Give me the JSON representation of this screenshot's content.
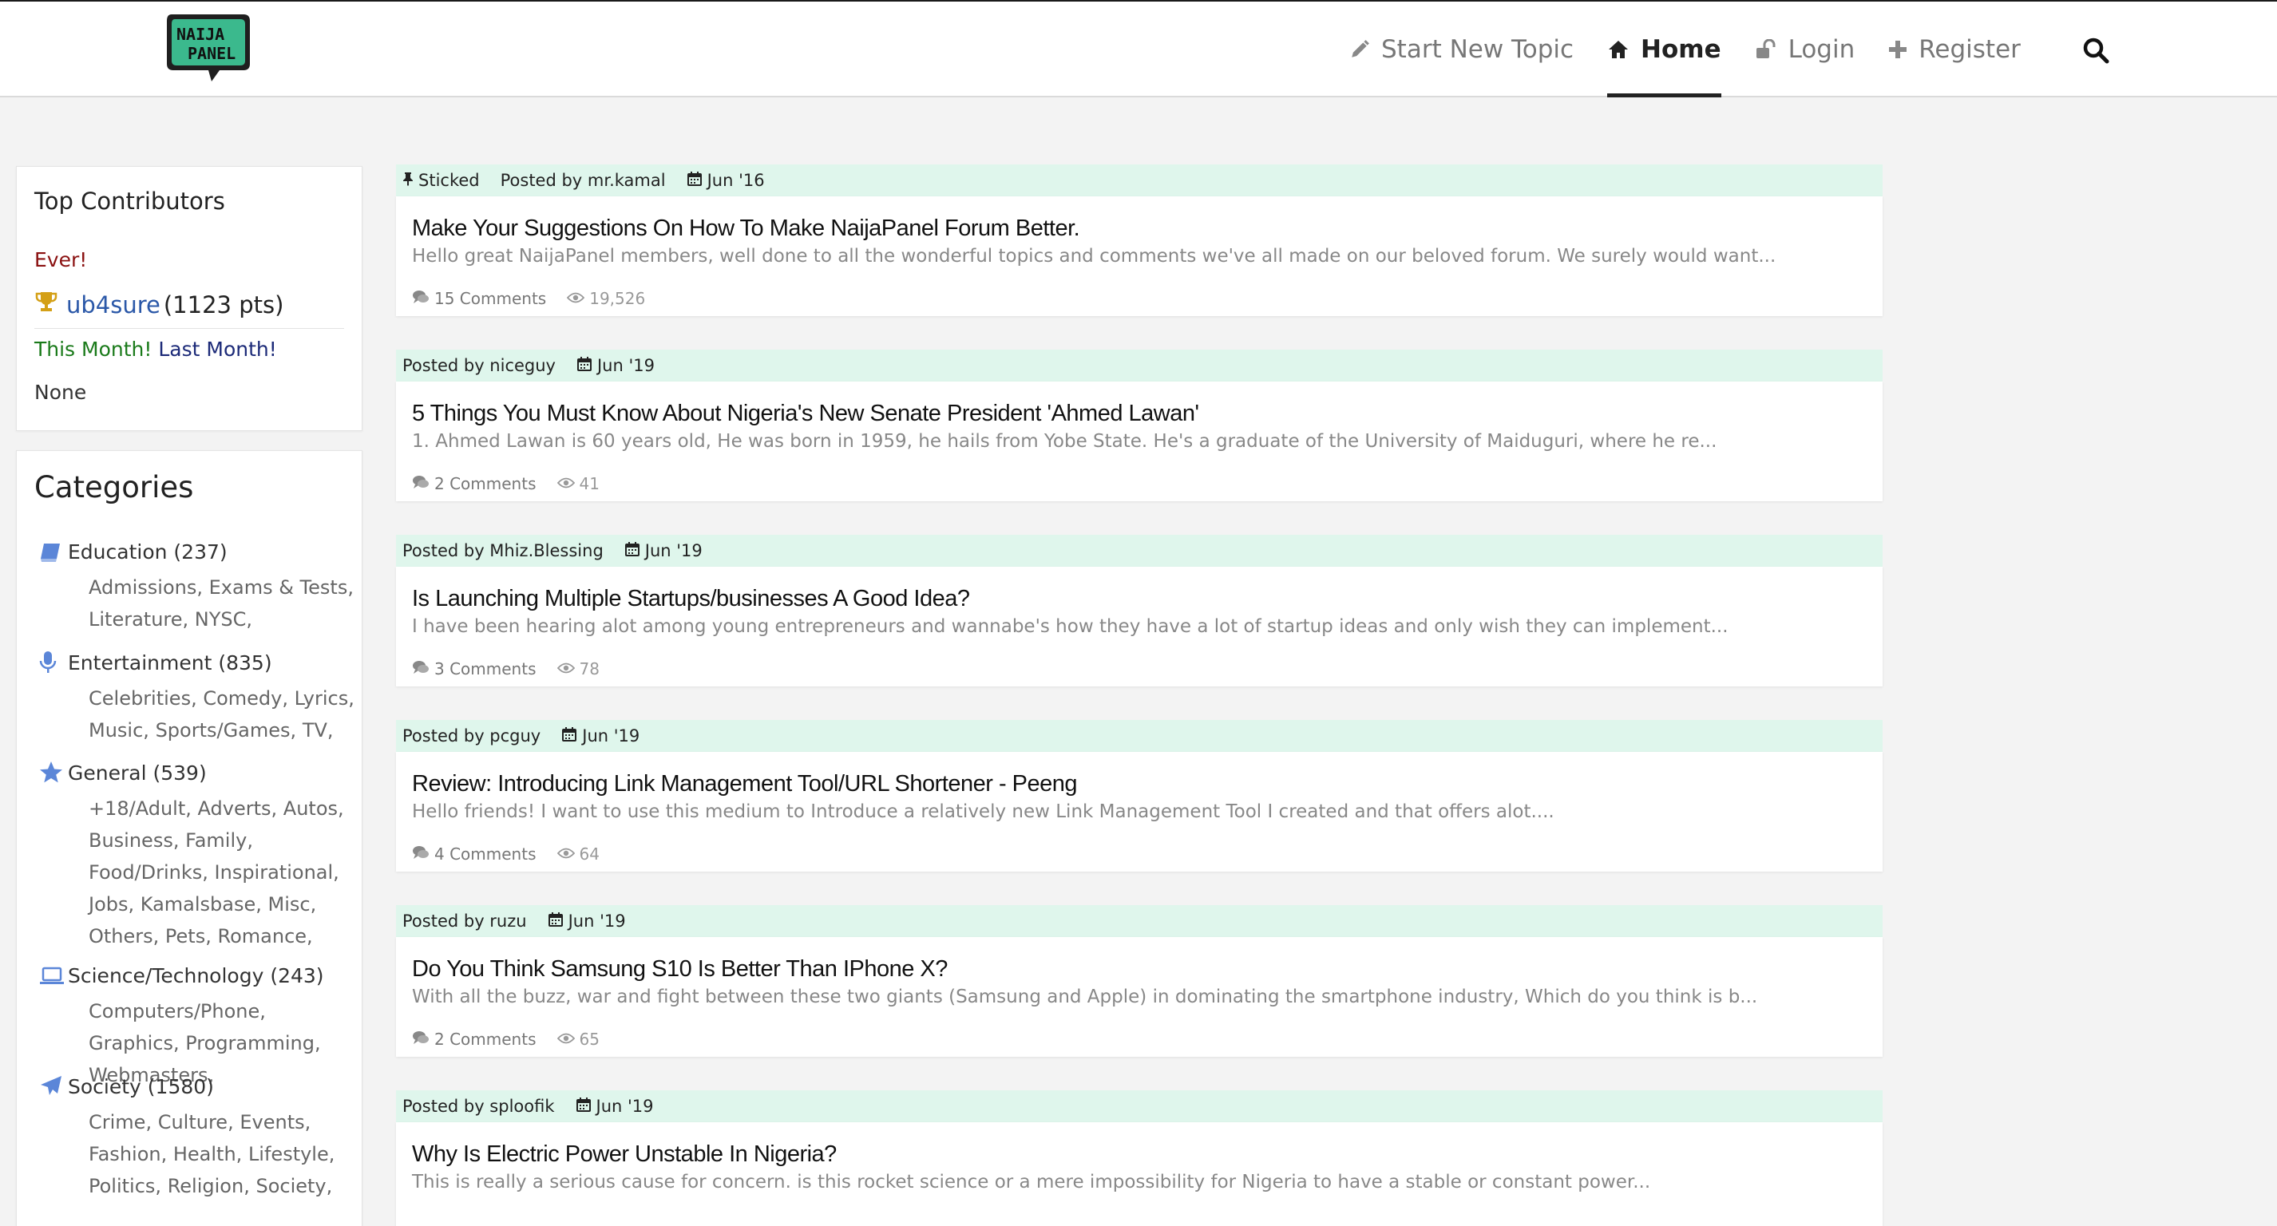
{
  "brand": {
    "logo_line1": "NAIJA",
    "logo_line2": "PANEL",
    "logo_color": "#3bb98d"
  },
  "nav": {
    "start_new_topic": "Start New Topic",
    "home": "Home",
    "login": "Login",
    "register": "Register"
  },
  "contributors": {
    "title": "Top Contributors",
    "ever_label": "Ever!",
    "top_user": {
      "name": "ub4sure",
      "points": "(1123 pts)"
    },
    "this_month": "This Month!",
    "last_month": "Last Month!",
    "none_text": "None"
  },
  "categories": {
    "title": "Categories",
    "items": [
      {
        "name": "Education (237)",
        "icon": "book-icon",
        "subs": [
          "Admissions",
          "Exams & Tests",
          "Literature",
          "NYSC"
        ]
      },
      {
        "name": "Entertainment (835)",
        "icon": "microphone-icon",
        "subs": [
          "Celebrities",
          "Comedy",
          "Lyrics",
          "Music",
          "Sports/Games",
          "TV"
        ]
      },
      {
        "name": "General (539)",
        "icon": "star-icon",
        "subs": [
          "+18/Adult",
          "Adverts",
          "Autos",
          "Business",
          "Family",
          "Food/Drinks",
          "Inspirational",
          "Jobs",
          "Kamalsbase",
          "Misc",
          "Others",
          "Pets",
          "Romance"
        ]
      },
      {
        "name": "Science/Technology (243)",
        "icon": "laptop-icon",
        "subs": [
          "Computers/Phone",
          "Graphics",
          "Programming",
          "Webmasters"
        ]
      },
      {
        "name": "Society (1580)",
        "icon": "plane-icon",
        "subs": [
          "Crime",
          "Culture",
          "Events",
          "Fashion",
          "Health",
          "Lifestyle",
          "Politics",
          "Religion",
          "Society"
        ]
      }
    ]
  },
  "posts": [
    {
      "sticked": "Sticked",
      "author": "Posted by mr.kamal",
      "date": "Jun '16",
      "title": "Make Your Suggestions On How To Make NaijaPanel Forum Better.",
      "excerpt": "Hello great NaijaPanel members, well done to all the wonderful topics and comments we've all made on our beloved forum. We surely would want...",
      "comments": "15 Comments",
      "views": "19,526"
    },
    {
      "author": "Posted by niceguy",
      "date": "Jun '19",
      "title": "5 Things You Must Know About Nigeria's New Senate President 'Ahmed Lawan'",
      "excerpt": "1. Ahmed Lawan is 60 years old, He was born in 1959, he hails from Yobe State. He's a graduate of the University of Maiduguri, where he re...",
      "comments": "2 Comments",
      "views": "41"
    },
    {
      "author": "Posted by Mhiz.Blessing",
      "date": "Jun '19",
      "title": "Is Launching Multiple Startups/businesses A Good Idea?",
      "excerpt": "I have been hearing alot among young entrepreneurs  and wannabe's how they have a lot of startup ideas and only wish they can implement...",
      "comments": "3 Comments",
      "views": "78"
    },
    {
      "author": "Posted by pcguy",
      "date": "Jun '19",
      "title": "Review: Introducing Link Management Tool/URL Shortener - Peeng",
      "excerpt": "Hello friends! I want to use this medium to Introduce a relatively new Link Management Tool I created and that offers alot....",
      "comments": "4 Comments",
      "views": "64"
    },
    {
      "author": "Posted by ruzu",
      "date": "Jun '19",
      "title": "Do You Think Samsung S10 Is Better Than IPhone X?",
      "excerpt": "With all the buzz, war and fight between these two giants (Samsung and Apple) in dominating the smartphone industry, Which do you think is b...",
      "comments": "2 Comments",
      "views": "65"
    },
    {
      "author": "Posted by sploofik",
      "date": "Jun '19",
      "title": "Why Is Electric Power Unstable In Nigeria?",
      "excerpt": "This is really a serious cause for concern. is this rocket science or a mere impossibility for Nigeria to have a stable or constant power...",
      "comments": "",
      "views": ""
    }
  ]
}
